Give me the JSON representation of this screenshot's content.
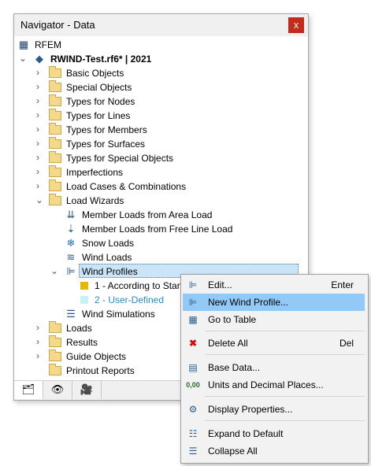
{
  "window": {
    "title": "Navigator - Data",
    "close_label": "x"
  },
  "tree": {
    "root": "RFEM",
    "project": "RWIND-Test.rf6* | 2021",
    "items": [
      "Basic Objects",
      "Special Objects",
      "Types for Nodes",
      "Types for Lines",
      "Types for Members",
      "Types for Surfaces",
      "Types for Special Objects",
      "Imperfections",
      "Load Cases & Combinations",
      "Load Wizards"
    ],
    "load_wizards": [
      "Member Loads from Area Load",
      "Member Loads from Free Line Load",
      "Snow Loads",
      "Wind Loads",
      "Wind Profiles"
    ],
    "wind_profiles": [
      "1 - According to Stand",
      "2 - User-Defined"
    ],
    "wind_simulations": "Wind Simulations",
    "bottom_items": [
      "Loads",
      "Results",
      "Guide Objects",
      "Printout Reports"
    ],
    "colors": {
      "profile1": "#e8b800",
      "profile2": "#c7f2f5",
      "profile2_text": "#2a8cc7"
    }
  },
  "tabs": [
    "data-tab-icon",
    "view-tab-icon",
    "camera-tab-icon"
  ],
  "context_menu": {
    "items": [
      {
        "label": "Edit...",
        "shortcut": "Enter"
      },
      {
        "label": "New Wind Profile...",
        "shortcut": ""
      },
      {
        "label": "Go to Table",
        "shortcut": ""
      },
      {
        "label": "Delete All",
        "shortcut": "Del"
      },
      {
        "label": "Base Data...",
        "shortcut": ""
      },
      {
        "label": "Units and Decimal Places...",
        "shortcut": ""
      },
      {
        "label": "Display Properties...",
        "shortcut": ""
      },
      {
        "label": "Expand to Default",
        "shortcut": ""
      },
      {
        "label": "Collapse All",
        "shortcut": ""
      }
    ]
  }
}
